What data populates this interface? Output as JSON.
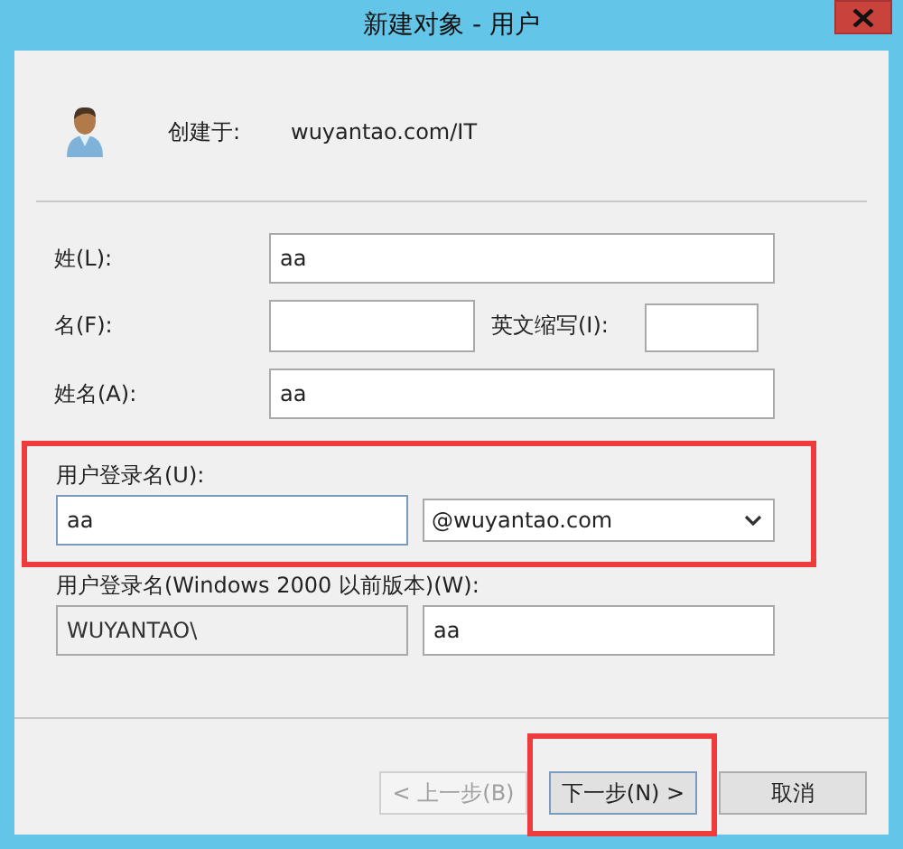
{
  "window": {
    "title": "新建对象 - 用户"
  },
  "header": {
    "label": "创建于:",
    "value": "wuyantao.com/IT"
  },
  "last_name": {
    "label": "姓(L):",
    "value": "aa"
  },
  "first_name": {
    "label": "名(F):"
  },
  "initials": {
    "label": "英文缩写(I):"
  },
  "full_name": {
    "label": "姓名(A):",
    "value": "aa"
  },
  "logon": {
    "label": "用户登录名(U):",
    "value": "aa",
    "focused": true,
    "highlighted": true,
    "domain": "@wuyantao.com"
  },
  "pre2000": {
    "label": "用户登录名(Windows 2000 以前版本)(W):",
    "prefix": "WUYANTAO\\",
    "value": "aa"
  },
  "buttons": [
    {
      "label": "< 上一步(B)",
      "disabled": true,
      "default": false,
      "highlighted": false
    },
    {
      "label": "下一步(N) >",
      "disabled": false,
      "default": true,
      "highlighted": true
    },
    {
      "label": "取消",
      "disabled": false,
      "default": false,
      "highlighted": false
    }
  ]
}
